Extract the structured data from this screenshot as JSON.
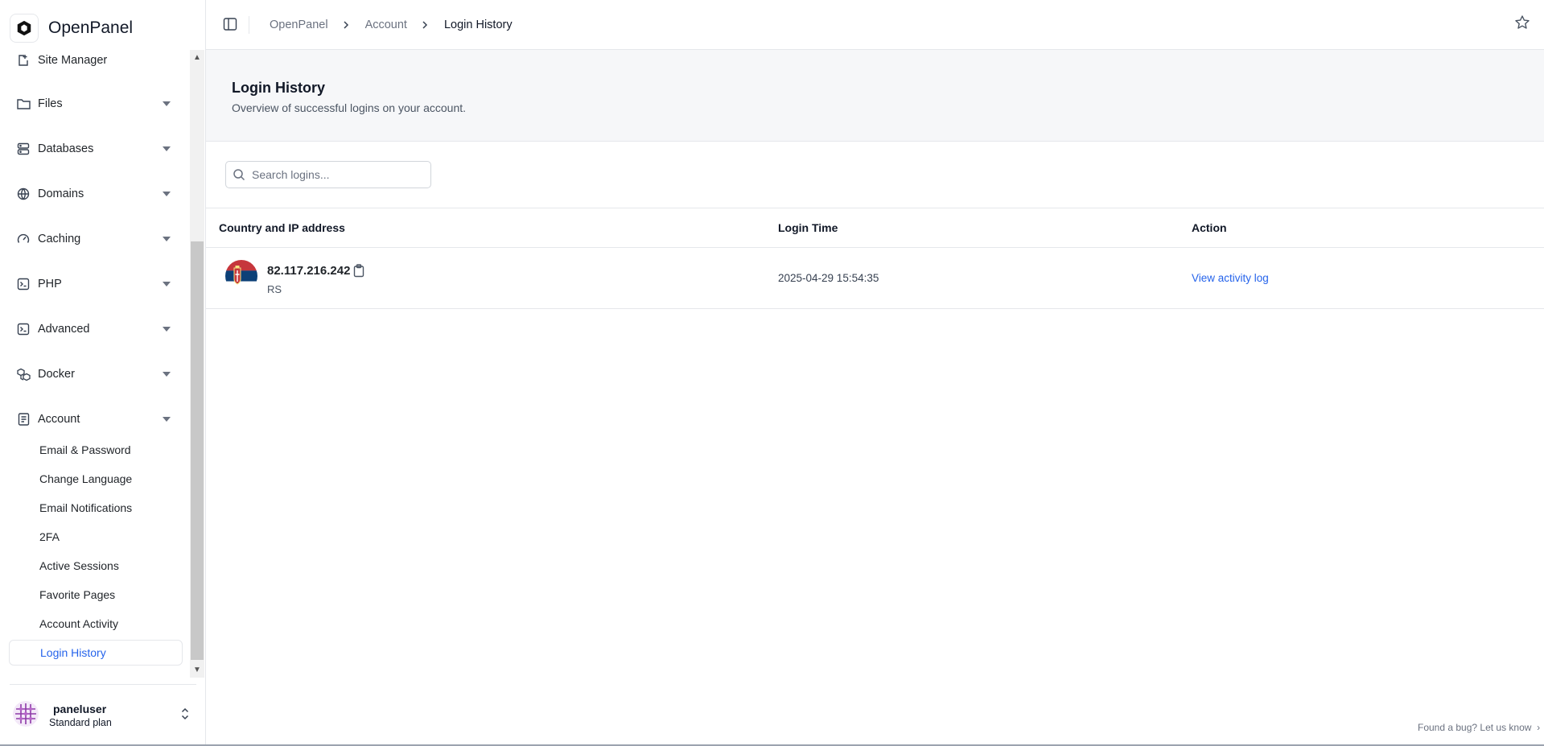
{
  "app": {
    "name": "OpenPanel"
  },
  "sidebar": {
    "items": [
      {
        "label": "Site Manager",
        "icon": "site-manager-icon",
        "expandable": false
      },
      {
        "label": "Files",
        "icon": "folder-icon",
        "expandable": true
      },
      {
        "label": "Databases",
        "icon": "database-icon",
        "expandable": true
      },
      {
        "label": "Domains",
        "icon": "globe-icon",
        "expandable": true
      },
      {
        "label": "Caching",
        "icon": "gauge-icon",
        "expandable": true
      },
      {
        "label": "PHP",
        "icon": "terminal-icon",
        "expandable": true
      },
      {
        "label": "Advanced",
        "icon": "terminal-icon",
        "expandable": true
      },
      {
        "label": "Docker",
        "icon": "boxes-icon",
        "expandable": true
      },
      {
        "label": "Account",
        "icon": "document-icon",
        "expandable": true
      }
    ],
    "account_subitems": [
      "Email & Password",
      "Change Language",
      "Email Notifications",
      "2FA",
      "Active Sessions",
      "Favorite Pages",
      "Account Activity",
      "Login History"
    ],
    "active_subitem": "Login History"
  },
  "user": {
    "name": "paneluser",
    "plan": "Standard plan"
  },
  "breadcrumb": [
    "OpenPanel",
    "Account",
    "Login History"
  ],
  "page": {
    "title": "Login History",
    "subtitle": "Overview of successful logins on your account."
  },
  "search": {
    "placeholder": "Search logins...",
    "value": ""
  },
  "table": {
    "columns": [
      "Country and IP address",
      "Login Time",
      "Action"
    ],
    "rows": [
      {
        "ip": "82.117.216.242",
        "country": "RS",
        "time": "2025-04-29 15:54:35",
        "action": "View activity log"
      }
    ]
  },
  "footer": {
    "bug_report": "Found a bug? Let us know"
  },
  "colors": {
    "accent": "#2563eb",
    "header_bg": "#f6f7f9",
    "border": "#e5e7eb"
  }
}
